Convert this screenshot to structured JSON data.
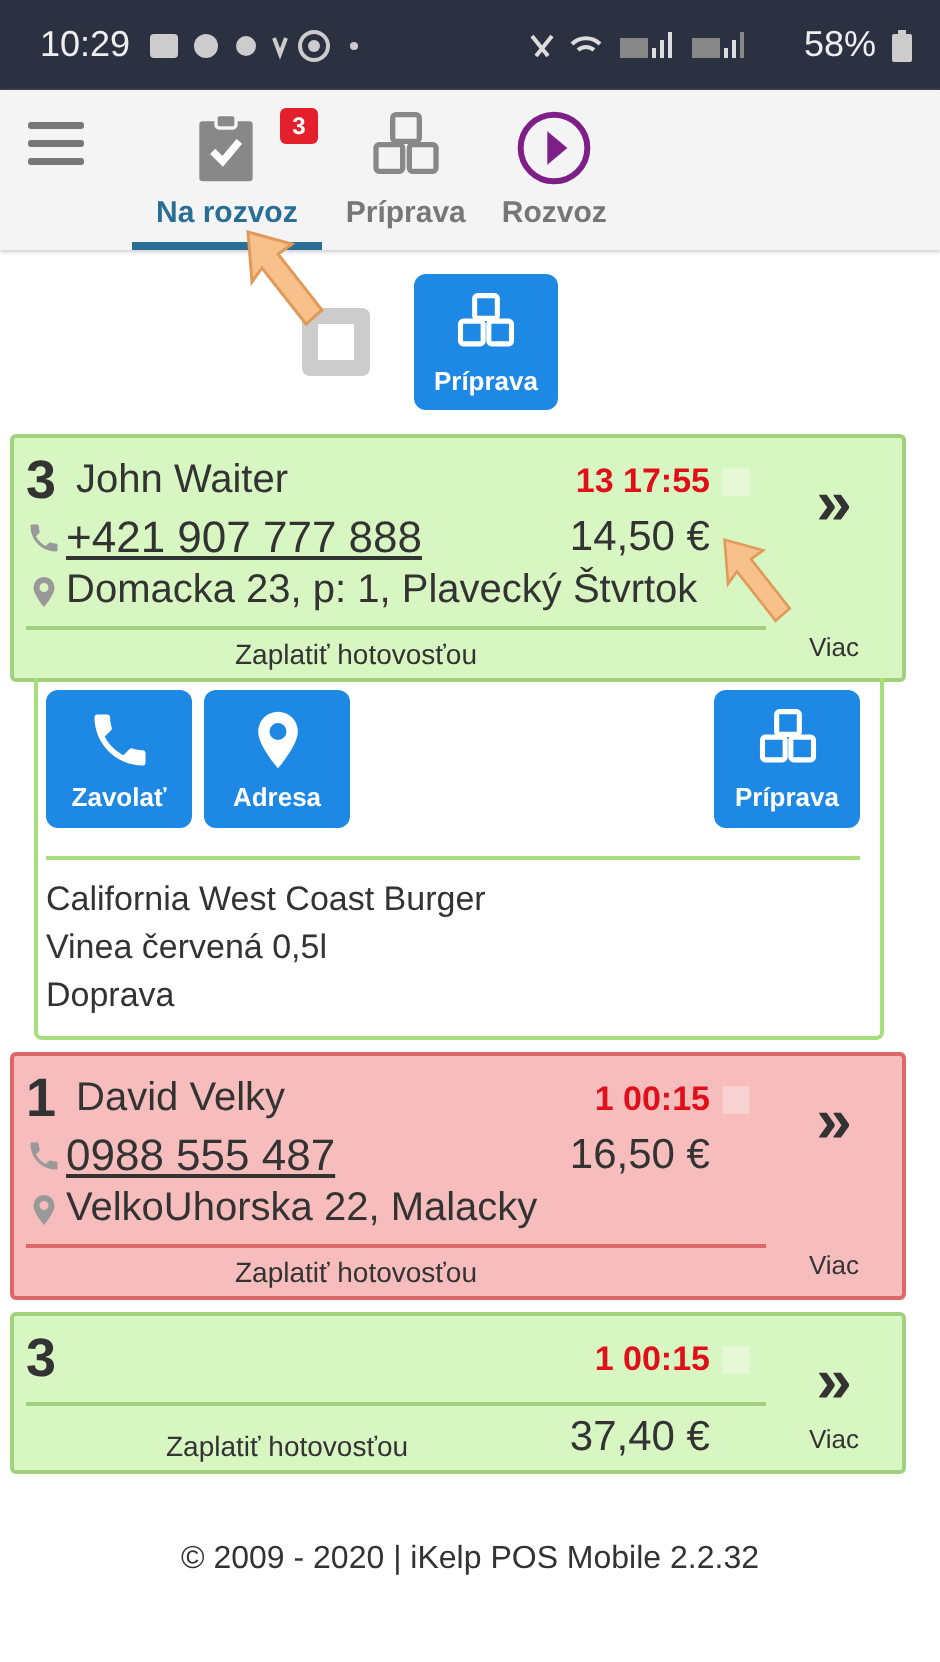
{
  "status_bar": {
    "time": "10:29",
    "battery": "58%"
  },
  "tabs": [
    {
      "label": "Na rozvoz",
      "selected": true,
      "badge": "3"
    },
    {
      "label": "Príprava",
      "selected": false
    },
    {
      "label": "Rozvoz",
      "selected": false
    }
  ],
  "filters": [
    {
      "kind": "blank",
      "selected": false
    },
    {
      "kind": "boxes",
      "label": "Príprava",
      "selected": true
    }
  ],
  "orders": [
    {
      "number": "3",
      "name": "John Waiter",
      "phone": "+421 907 777 888",
      "address": "Domacka 23, p: 1, Plavecký Štvrtok",
      "time": "13 17:55",
      "price": "14,50 €",
      "payment": "Zaplatiť hotovosťou",
      "open": "»",
      "more": "Viac",
      "color": "#d8f6c2",
      "expanded": true,
      "actions": [
        {
          "kind": "phone",
          "label": "Zavolať"
        },
        {
          "kind": "pin",
          "label": "Adresa"
        },
        {
          "kind": "boxes",
          "label": "Príprava"
        }
      ],
      "items": [
        "California West Coast Burger",
        "Vinea červená 0,5l",
        "Doprava"
      ]
    },
    {
      "number": "1",
      "name": "David Velky",
      "phone": "0988 555 487",
      "address": "VelkoUhorska 22, Malacky",
      "time": "1 00:15",
      "price": "16,50 €",
      "payment": "Zaplatiť hotovosťou",
      "open": "»",
      "more": "Viac",
      "color": "#f7bcbc",
      "expanded": false
    },
    {
      "number": "3",
      "time": "1 00:15",
      "price": "37,40 €",
      "payment": "Zaplatiť hotovosťou",
      "open": "»",
      "more": "Viac",
      "color": "#d8f6c2",
      "expanded": false
    }
  ],
  "footer": "© 2009 - 2020 | iKelp POS Mobile 2.2.32"
}
